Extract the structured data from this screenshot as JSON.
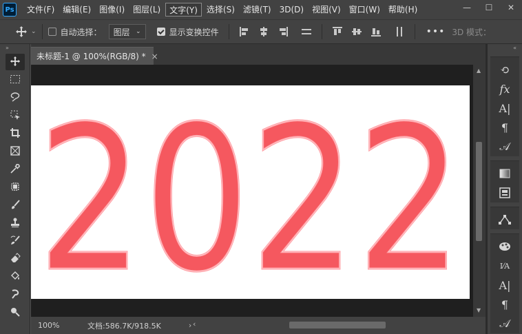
{
  "app": {
    "logo": "Ps"
  },
  "menu": {
    "items": [
      "文件(F)",
      "编辑(E)",
      "图像(I)",
      "图层(L)",
      "文字(Y)",
      "选择(S)",
      "滤镜(T)",
      "3D(D)",
      "视图(V)",
      "窗口(W)",
      "帮助(H)"
    ],
    "active_index": 4
  },
  "window_controls": {
    "minimize": "—",
    "maximize": "☐",
    "close": "✕"
  },
  "options_bar": {
    "tool_icon": "move-tool-icon",
    "auto_select_checked": false,
    "auto_select_label": "自动选择：",
    "auto_select_target": "图层",
    "show_transform_checked": true,
    "show_transform_label": "显示变换控件",
    "more_label": "•••",
    "mode_3d_label": "3D 模式："
  },
  "document": {
    "tab_title": "未标题-1 @ 100%(RGB/8) *",
    "close_glyph": "×",
    "canvas_text": "2022",
    "text_color": "#f5585f",
    "text_highlight": "#ffd0d3"
  },
  "status": {
    "zoom": "100%",
    "doc_info": "文档:586.7K/918.5K",
    "arrow_right": "›",
    "arrow_left": "‹"
  },
  "left_toolbar": {
    "tools": [
      "move-tool-icon",
      "marquee-tool-icon",
      "lasso-tool-icon",
      "object-select-tool-icon",
      "crop-tool-icon",
      "frame-tool-icon",
      "eyedropper-tool-icon",
      "healing-tool-icon",
      "brush-tool-icon",
      "stamp-tool-icon",
      "history-brush-icon",
      "eraser-tool-icon",
      "paint-bucket-icon",
      "smudge-tool-icon",
      "dodge-tool-icon"
    ]
  },
  "right_panel": {
    "group1": [
      "history-icon",
      "fx-icon",
      "character-icon",
      "paragraph-icon",
      "glyphs-icon"
    ],
    "group1_glyphs": [
      "⟲",
      "fx",
      "A|",
      "¶",
      "𝒜"
    ],
    "group2": [
      "gradient-icon",
      "swatches-icon"
    ],
    "group3": [
      "paths-icon"
    ],
    "group4": [
      "brush-settings-icon",
      "character-style-icon",
      "char-panel-icon",
      "para-panel-icon",
      "glyph-panel-icon"
    ],
    "group4_glyphs": [
      "🎨",
      "I⁄A",
      "A|",
      "¶",
      "𝒜"
    ]
  },
  "colors": {
    "ui_dark": "#424242",
    "pasteboard": "#1f1f1f",
    "canvas": "#ffffff",
    "accent": "#31a8ff"
  }
}
